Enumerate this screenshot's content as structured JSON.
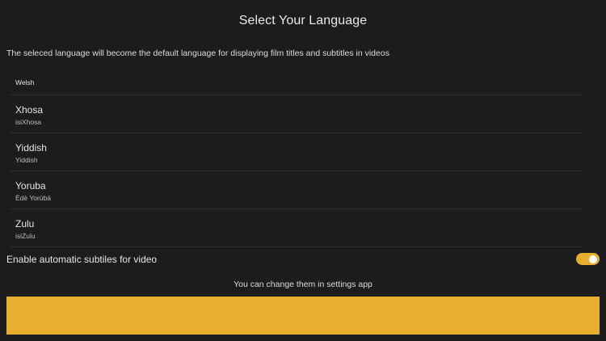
{
  "header": {
    "title": "Select Your Language",
    "description": "The seleced language will become the default language for displaying film titles and subtitles in videos"
  },
  "languages": [
    {
      "name": "Welsh",
      "native": ""
    },
    {
      "name": "Xhosa",
      "native": "isiXhosa"
    },
    {
      "name": "Yiddish",
      "native": "Yiddish"
    },
    {
      "name": "Yoruba",
      "native": "Èdè Yorùbá"
    },
    {
      "name": "Zulu",
      "native": "isiZulu"
    }
  ],
  "settings": {
    "auto_subtitles_label": "Enable automatic subtiles for video",
    "auto_subtitles_enabled": true,
    "hint": "You can change them in settings app"
  },
  "footer": {
    "button_label": "",
    "accent_color": "#e8ae2e"
  }
}
